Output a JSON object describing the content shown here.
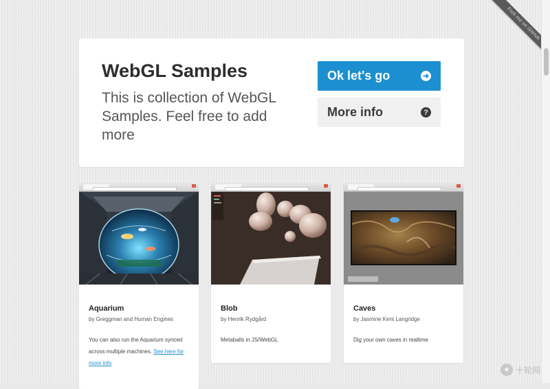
{
  "ribbon": {
    "label": "Fork me on GitHub"
  },
  "hero": {
    "title": "WebGL Samples",
    "description": "This is collection of WebGL Samples. Feel free to add more",
    "primary_button": "Ok let's go",
    "secondary_button": "More info",
    "primary_icon": "arrow-right-circle-icon",
    "secondary_icon": "question-circle-icon"
  },
  "samples": [
    {
      "title": "Aquarium",
      "author": "by Greggman and Human Engines",
      "description": "You can also run the Aquarium synced across multiple machines.",
      "link_text": "See here for more info"
    },
    {
      "title": "Blob",
      "author": "by Henrik Rydgård",
      "description": "Metaballs in JS/WebGL"
    },
    {
      "title": "Caves",
      "author": "by Jasmine Kent Langridge",
      "description": "Dig your own caves in realtime"
    }
  ],
  "watermark": {
    "label": "十轮网"
  },
  "colors": {
    "accent": "#1c8fd0",
    "background": "#ebebeb",
    "card": "#ffffff"
  }
}
